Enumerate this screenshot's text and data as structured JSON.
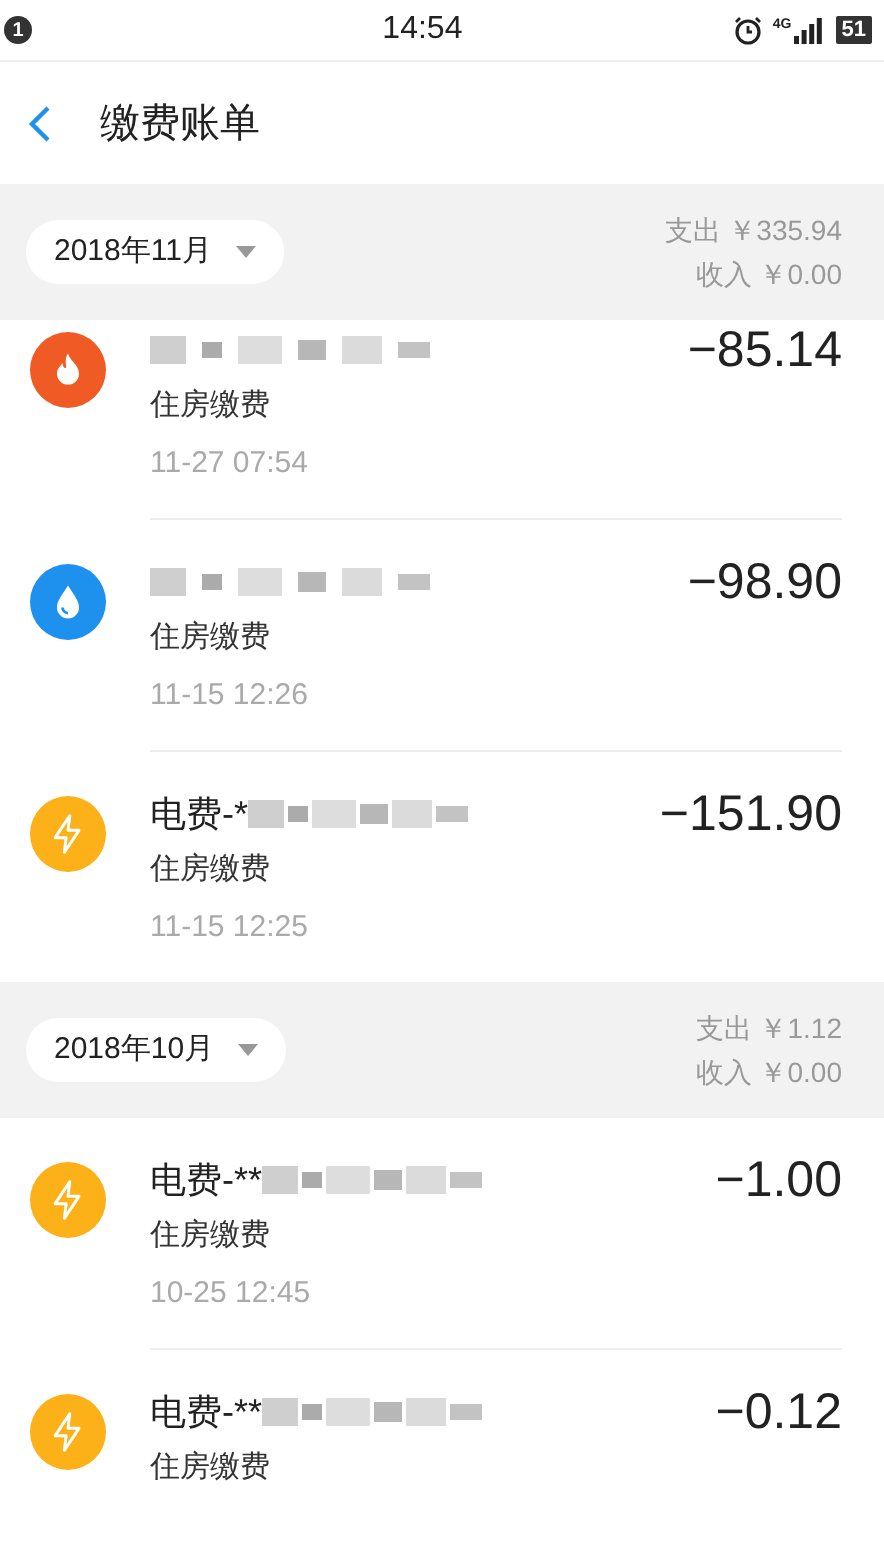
{
  "status_bar": {
    "notification_count": "1",
    "time": "14:54",
    "network": "4G",
    "battery": "51"
  },
  "header": {
    "title": "缴费账单"
  },
  "groups": [
    {
      "month": "2018年11月",
      "expense": "支出 ￥335.94",
      "income": "收入 ￥0.00",
      "bills": [
        {
          "kind": "gas",
          "category": "住房缴费",
          "time": "11-27  07:54",
          "amount": "−85.14"
        },
        {
          "kind": "water",
          "category": "住房缴费",
          "time": "11-15  12:26",
          "amount": "−98.90"
        },
        {
          "kind": "electric",
          "title": "电费-*",
          "category": "住房缴费",
          "time": "11-15  12:25",
          "amount": "−151.90"
        }
      ]
    },
    {
      "month": "2018年10月",
      "expense": "支出 ￥1.12",
      "income": "收入 ￥0.00",
      "bills": [
        {
          "kind": "electric",
          "title": "电费-**",
          "category": "住房缴费",
          "time": "10-25  12:45",
          "amount": "−1.00"
        },
        {
          "kind": "electric",
          "title": "电费-**",
          "category": "住房缴费",
          "amount": "−0.12"
        }
      ]
    }
  ]
}
